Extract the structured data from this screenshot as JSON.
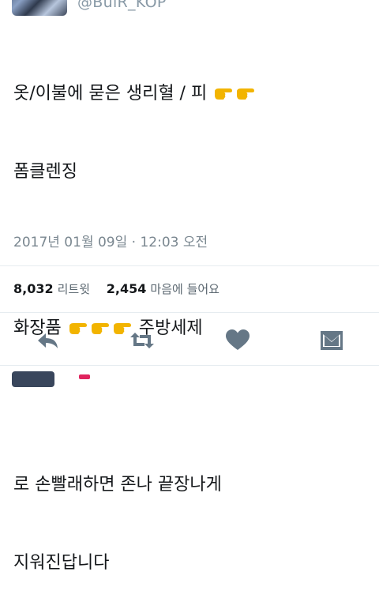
{
  "header": {
    "handle": "@BulR_KOP"
  },
  "tweet": {
    "lines": [
      {
        "text": "옷/이불에 묻은 생리혈 / 피 ",
        "emojis": 2
      },
      {
        "text": "폼클렌징",
        "emojis": 0
      },
      {
        "text": "",
        "emojis": 0
      },
      {
        "text": "화장품 ",
        "emojis": 3,
        "after": " 주방세제"
      },
      {
        "text": "",
        "emojis": 0
      },
      {
        "text": "로 손빨래하면 존나 끝장나게",
        "emojis": 0
      },
      {
        "text": "지워진답니다",
        "emojis": 0
      }
    ],
    "timestamp": "2017년 01월 09일 · 12:03 오전"
  },
  "stats": {
    "retweets_count": "8,032",
    "retweets_label": "리트윗",
    "likes_count": "2,454",
    "likes_label": "마음에 들어요"
  },
  "actions": {
    "reply_icon": "reply-icon",
    "retweet_icon": "retweet-icon",
    "like_icon": "heart-icon",
    "dm_icon": "envelope-icon",
    "icon_color": "#657786"
  },
  "colors": {
    "emoji": "#f2b400",
    "accent_red": "#e0245e"
  }
}
